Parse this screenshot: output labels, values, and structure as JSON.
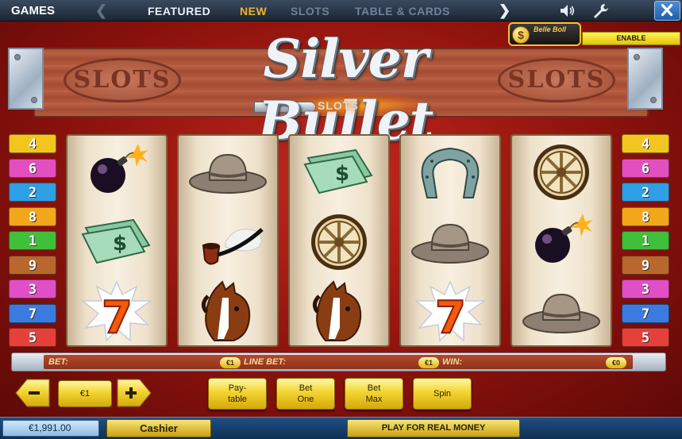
{
  "topbar": {
    "games": "GAMES",
    "tabs": [
      {
        "label": "FEATURED"
      },
      {
        "label": "NEW"
      },
      {
        "label": "SLOTS"
      },
      {
        "label": "TABLE & CARDS"
      }
    ],
    "icons": [
      "chevron-left-icon",
      "chevron-right-icon",
      "volume-icon",
      "wrench-icon",
      "close-icon"
    ]
  },
  "header": {
    "logo": "Silver Bullet",
    "logo_sub": "SLOTS",
    "sign_left": "SLOTS",
    "sign_right": "SLOTS"
  },
  "bellbox": {
    "coin": "$",
    "label": "Belle Boll",
    "enable": "ENABLE"
  },
  "paylines_left": [
    "4",
    "6",
    "2",
    "8",
    "1",
    "9",
    "3",
    "7",
    "5"
  ],
  "paylines_right": [
    "4",
    "6",
    "2",
    "8",
    "1",
    "9",
    "3",
    "7",
    "5"
  ],
  "payline_colors": [
    "#f3c61f",
    "#e34fc0",
    "#2f9fe6",
    "#f2a81a",
    "#3fbf3a",
    "#b9672c",
    "#e04fc6",
    "#3b7be0",
    "#e5403a"
  ],
  "reels": [
    [
      "bomb",
      "money",
      "seven"
    ],
    [
      "hat",
      "pipe",
      "horse"
    ],
    [
      "money",
      "wheel",
      "horse"
    ],
    [
      "horseshoe",
      "hat",
      "seven"
    ],
    [
      "wheel",
      "bomb",
      "hat"
    ]
  ],
  "betbar": {
    "bet_label": "BET:",
    "bet_value": "€1",
    "line_bet_label": "LINE BET:",
    "line_bet_value": "€1",
    "win_label": "WIN:",
    "win_value": "€0"
  },
  "controls": {
    "coin_value": "€1",
    "paytable": "Pay-\ntable",
    "bet_one": "Bet\nOne",
    "bet_max": "Bet\nMax",
    "spin": "Spin"
  },
  "footer": {
    "balance": "€1,991.00",
    "cashier": "Cashier",
    "real_money": "PLAY FOR REAL MONEY"
  }
}
